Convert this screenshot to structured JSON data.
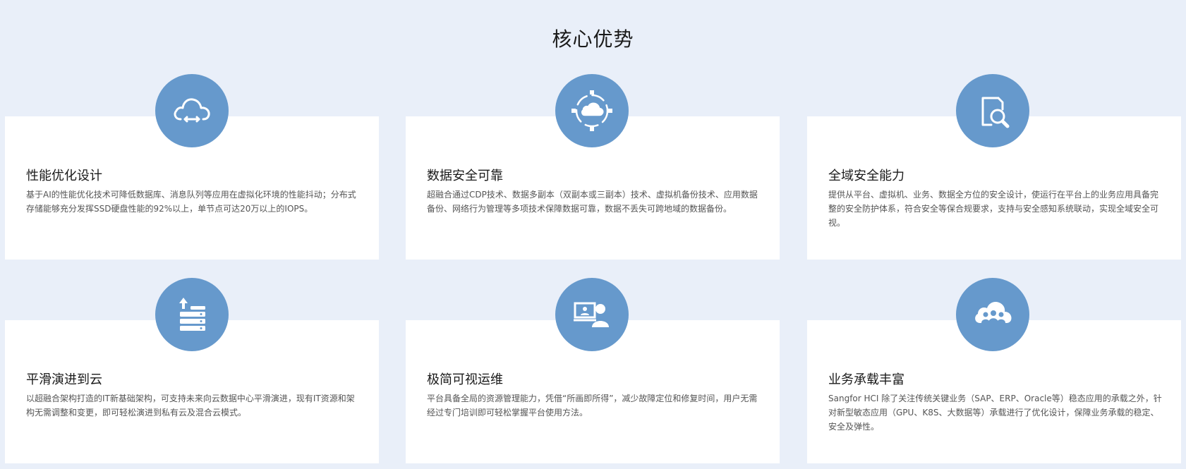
{
  "section": {
    "title": "核心优势"
  },
  "colors": {
    "background": "#e9eff9",
    "card": "#ffffff",
    "icon_circle": "#6699cc"
  },
  "cards": [
    {
      "icon": "cloud-sync-icon",
      "title": "性能优化设计",
      "desc": "基于AI的性能优化技术可降低数据库、消息队列等应用在虚拟化环境的性能抖动；分布式存储能够充分发挥SSD硬盘性能的92%以上，单节点可达20万以上的IOPS。"
    },
    {
      "icon": "cloud-network-icon",
      "title": "数据安全可靠",
      "desc": "超融合通过CDP技术、数据多副本（双副本或三副本）技术、虚拟机备份技术、应用数据备份、网络行为管理等多项技术保障数据可靠，数据不丢失可跨地域的数据备份。"
    },
    {
      "icon": "document-search-icon",
      "title": "全域安全能力",
      "desc": "提供从平台、虚拟机、业务、数据全方位的安全设计，使运行在平台上的业务应用具备完整的安全防护体系，符合安全等保合规要求，支持与安全感知系统联动，实现全域安全可视。"
    },
    {
      "icon": "server-upload-icon",
      "title": "平滑演进到云",
      "desc": "以超融合架构打造的IT新基础架构，可支持未来向云数据中心平滑演进，现有IT资源和架构无需调整和变更，即可轻松演进到私有云及混合云模式。"
    },
    {
      "icon": "monitor-user-icon",
      "title": "极简可视运维",
      "desc": "平台具备全局的资源管理能力，凭借“所画即所得”，减少故障定位和修复时间，用户无需经过专门培训即可轻松掌握平台使用方法。"
    },
    {
      "icon": "cloud-users-icon",
      "title": "业务承载丰富",
      "desc": "Sangfor HCI 除了关注传统关键业务（SAP、ERP、Oracle等）稳态应用的承载之外，针对新型敏态应用（GPU、K8S、大数据等）承载进行了优化设计，保障业务承载的稳定、安全及弹性。"
    }
  ]
}
